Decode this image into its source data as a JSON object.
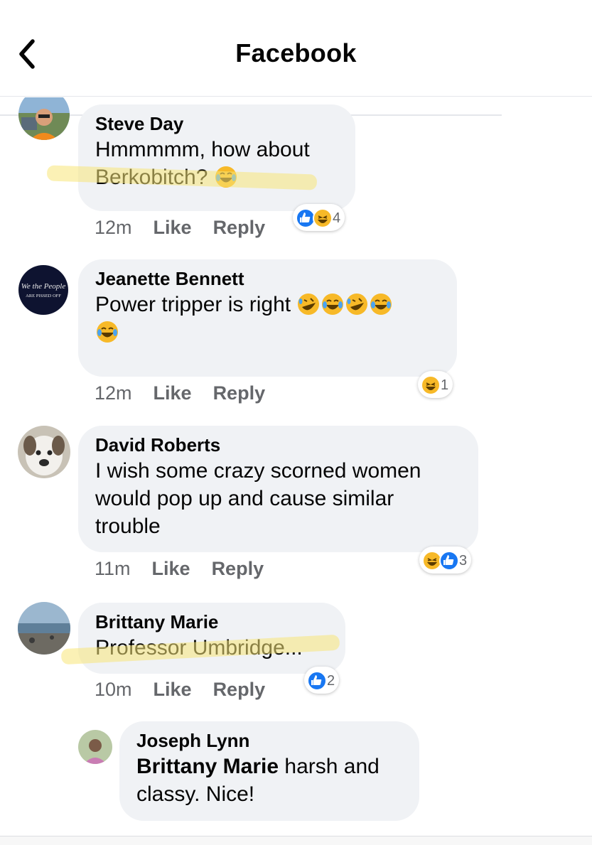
{
  "header": {
    "title": "Facebook",
    "back_icon": "chevron-left-icon"
  },
  "comments": [
    {
      "author": "Steve Day",
      "text": "Hmmmmm, how about Berkobitch?",
      "time": "12m",
      "like": "Like",
      "reply": "Reply",
      "reactions": [
        "like",
        "haha"
      ],
      "reaction_count": "4"
    },
    {
      "author": "Jeanette Bennett",
      "text": "Power tripper is right",
      "time": "12m",
      "like": "Like",
      "reply": "Reply",
      "reactions": [
        "haha"
      ],
      "reaction_count": "1",
      "avatar_text": [
        "We the People",
        "ARE PISSED OFF"
      ]
    },
    {
      "author": "David Roberts",
      "text": "I wish some crazy scorned women would pop up and cause similar trouble",
      "time": "11m",
      "like": "Like",
      "reply": "Reply",
      "reactions": [
        "haha",
        "like"
      ],
      "reaction_count": "3"
    },
    {
      "author": "Brittany Marie",
      "text": "Professor Umbridge...",
      "time": "10m",
      "like": "Like",
      "reply": "Reply",
      "reactions": [
        "like"
      ],
      "reaction_count": "2"
    }
  ],
  "reply": {
    "author": "Joseph Lynn",
    "mention": "Brittany Marie",
    "text": " harsh and classy. Nice!"
  },
  "colors": {
    "bubble": "#f0f2f5",
    "like_blue": "#1877f2",
    "haha_yellow": "#f7b928",
    "highlight": "#f7e678",
    "meta_gray": "#65676b"
  }
}
